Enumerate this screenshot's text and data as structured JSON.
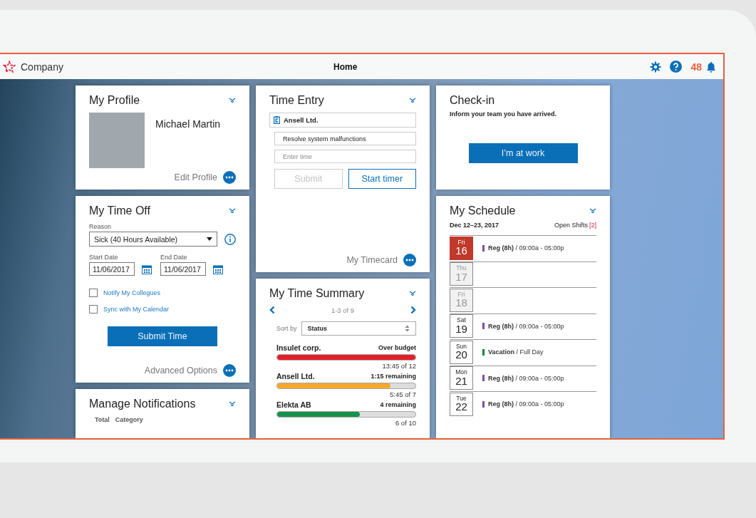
{
  "header": {
    "company": "Company",
    "title": "Home",
    "notification_count": "48"
  },
  "profile": {
    "title": "My Profile",
    "name": "Michael Martin",
    "link": "Edit Profile"
  },
  "time_off": {
    "title": "My Time Off",
    "reason_label": "Reason",
    "reason": "Sick (40 Hours Available)",
    "start_label": "Start Date",
    "start": "11/06/2017",
    "end_label": "End Date",
    "end": "11/06/2017",
    "options": [
      {
        "label": "Notify My Collegues",
        "checked": false
      },
      {
        "label": "Sync with My Calendar",
        "checked": false
      }
    ],
    "submit": "Submit Time",
    "link": "Advanced Options"
  },
  "notifications": {
    "title": "Manage Notifications",
    "columns": [
      "Total",
      "Category"
    ]
  },
  "time_entry": {
    "title": "Time Entry",
    "client": "Ansell Ltd.",
    "task": "Resolve system malfunctions",
    "time_placeholder": "Enter time",
    "submit": {
      "label": "Submit",
      "disabled": true
    },
    "start": "Start timer",
    "link": "My Timecard"
  },
  "summary": {
    "title": "My Time Summary",
    "range": "1-3 of 9",
    "sort_label": "Sort by",
    "sort": "Status",
    "items": [
      {
        "name": "Insulet corp.",
        "status": "Over budget",
        "level": 1,
        "color": "#e3202a",
        "detail": "13:45 of 12"
      },
      {
        "name": "Ansell Ltd.",
        "status": "1:15 remaining",
        "level": 0.82,
        "color": "#f5a82a",
        "detail": "5:45 of 7"
      },
      {
        "name": "Elekta AB",
        "status": "4 remaining",
        "level": 0.6,
        "color": "#17924a",
        "detail": "6 of 10"
      }
    ]
  },
  "checkin": {
    "title": "Check-in",
    "message": "Inform your team you have arrived.",
    "button": "I’m at work"
  },
  "schedule": {
    "title": "My Schedule",
    "range": "Dec 12–23, 2017",
    "open_label": "Open Shifts",
    "open_count": "[2]",
    "days": [
      {
        "weekday": "Fri",
        "day": "16",
        "selected": true,
        "disabled": false,
        "entry": "**Reg (8h)** / 09:00a - 05:00p",
        "color": "#7b4fa5"
      },
      {
        "weekday": "Thu",
        "day": "17",
        "selected": false,
        "disabled": true
      },
      {
        "weekday": "Fri",
        "day": "18",
        "selected": false,
        "disabled": true
      },
      {
        "weekday": "Sat",
        "day": "19",
        "selected": false,
        "disabled": false,
        "entry": "**Reg (8h)** / 09:00a - 05:00p",
        "color": "#7b4fa5"
      },
      {
        "weekday": "Sun",
        "day": "20",
        "selected": false,
        "disabled": false,
        "entry": "**Vacation** / Full Day",
        "color": "#16833f"
      },
      {
        "weekday": "Mon",
        "day": "21",
        "selected": false,
        "disabled": false,
        "entry": "**Reg (8h)** / 09:00a - 05:00p",
        "color": "#7b4fa5"
      },
      {
        "weekday": "Tue",
        "day": "22",
        "selected": false,
        "disabled": false,
        "entry": "**Reg (8h)** / 09:00a - 05:00p",
        "color": "#7b4fa5"
      }
    ]
  }
}
